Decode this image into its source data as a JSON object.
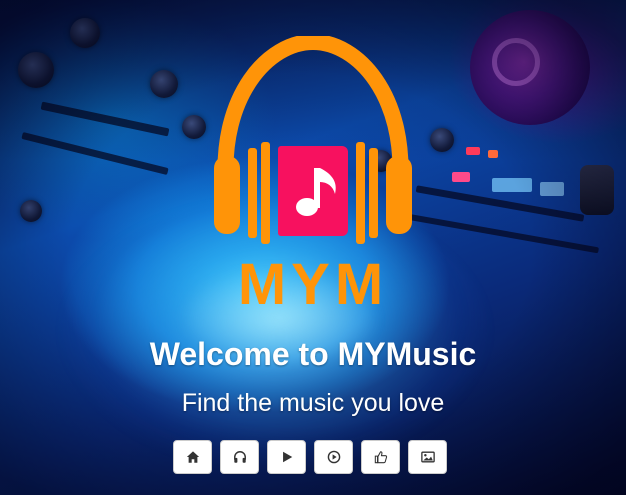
{
  "brand": {
    "logo_text": "MYM",
    "logo_colors": {
      "headphones": "#ff9408",
      "book": "#f7115f",
      "note": "#ffffff"
    }
  },
  "hero": {
    "title": "Welcome to MYMusic",
    "subtitle": "Find the music you love"
  },
  "toolbar": {
    "buttons": [
      {
        "icon": "home-icon"
      },
      {
        "icon": "headphones-icon"
      },
      {
        "icon": "play-icon"
      },
      {
        "icon": "play-circle-icon"
      },
      {
        "icon": "thumbs-up-icon"
      },
      {
        "icon": "picture-icon"
      }
    ]
  }
}
